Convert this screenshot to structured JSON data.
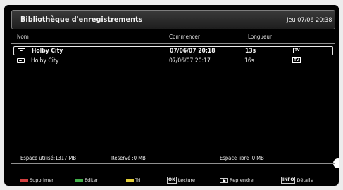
{
  "header": {
    "title": "Bibliothèque d'enregistrements",
    "clock": "Jeu 07/06 20:38"
  },
  "columns": {
    "name": "Nom",
    "start": "Commencer",
    "length": "Longueur"
  },
  "recordings": [
    {
      "name": "Holby City",
      "start": "07/06/07 20:18",
      "length": "13s",
      "badge": "TV",
      "selected": true
    },
    {
      "name": "Holby City",
      "start": "07/06/07 20:17",
      "length": "16s",
      "badge": "TV",
      "selected": false
    }
  ],
  "storage": {
    "used": "Espace utilisé:1317 MB",
    "reserved": "Reservé :0 MB",
    "free": "Espace libre :0 MB"
  },
  "legend": {
    "delete": {
      "label": "Supprimer",
      "color": "#d24040"
    },
    "edit": {
      "label": "Editer",
      "color": "#42b04a"
    },
    "sort": {
      "label": "Tri",
      "color": "#e3cf3a"
    },
    "play": {
      "key": "OK",
      "label": "Lecture"
    },
    "resume": {
      "label": "Reprendre"
    },
    "details": {
      "key": "INFO",
      "label": "Détails"
    }
  }
}
